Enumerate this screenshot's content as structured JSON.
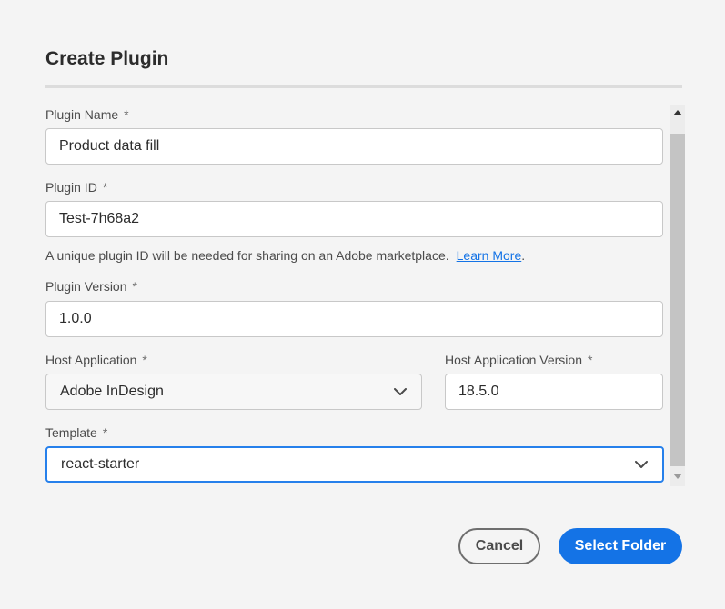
{
  "dialog": {
    "title": "Create Plugin"
  },
  "form": {
    "plugin_name": {
      "label": "Plugin Name",
      "required_mark": "*",
      "value": "Product data fill"
    },
    "plugin_id": {
      "label": "Plugin ID",
      "required_mark": "*",
      "value": "Test-7h68a2"
    },
    "plugin_id_help": {
      "text": "A unique plugin ID will be needed for sharing on an Adobe marketplace.",
      "link_text": "Learn More",
      "trailing": "."
    },
    "plugin_version": {
      "label": "Plugin Version",
      "required_mark": "*",
      "value": "1.0.0"
    },
    "host_application": {
      "label": "Host Application",
      "required_mark": "*",
      "selected": "Adobe InDesign"
    },
    "host_application_version": {
      "label": "Host Application Version",
      "required_mark": "*",
      "value": "18.5.0"
    },
    "template": {
      "label": "Template",
      "required_mark": "*",
      "selected": "react-starter"
    }
  },
  "buttons": {
    "cancel_label": "Cancel",
    "select_folder_label": "Select Folder"
  },
  "icons": {
    "chevron": "chevron-down-icon",
    "scroll_up": "triangle-up-icon",
    "scroll_down": "triangle-down-icon"
  },
  "colors": {
    "accent": "#1473e6",
    "focus_border": "#2680eb",
    "background": "#f4f4f4"
  }
}
